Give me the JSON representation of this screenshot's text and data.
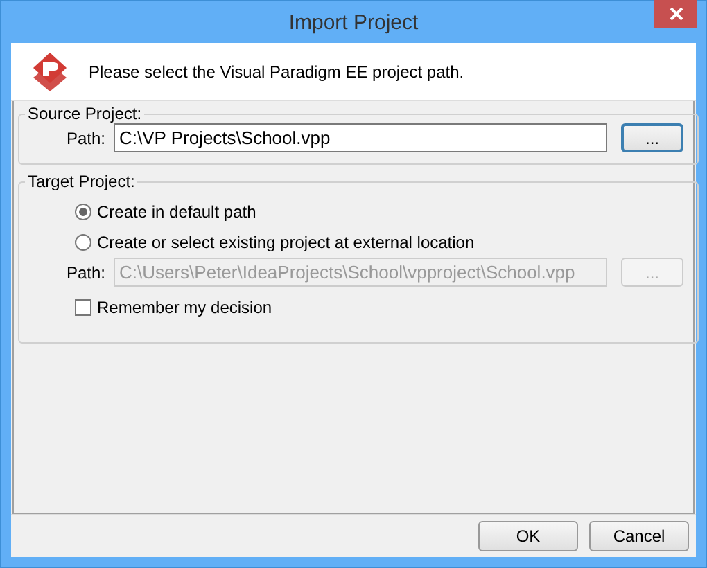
{
  "window": {
    "title": "Import Project"
  },
  "header": {
    "message": "Please select the Visual Paradigm EE project path."
  },
  "source_project": {
    "title": "Source Project:",
    "path_label": "Path:",
    "path_value": "C:\\VP Projects\\School.vpp",
    "path_disabled": false,
    "browse_button": {
      "label": "...",
      "disabled": false,
      "focused": true
    }
  },
  "target_project": {
    "title": "Target Project:",
    "options": [
      {
        "label": "Create in default path",
        "selected": true
      },
      {
        "label": "Create or select existing project at external location",
        "selected": false
      }
    ],
    "path_label": "Path:",
    "path_value": "C:\\Users\\Peter\\IdeaProjects\\School\\vpproject\\School.vpp",
    "path_disabled": true,
    "browse_button": {
      "label": "...",
      "disabled": true,
      "focused": false
    },
    "remember": {
      "label": "Remember my decision",
      "checked": false
    }
  },
  "buttons": [
    {
      "label": "OK"
    },
    {
      "label": "Cancel"
    }
  ]
}
